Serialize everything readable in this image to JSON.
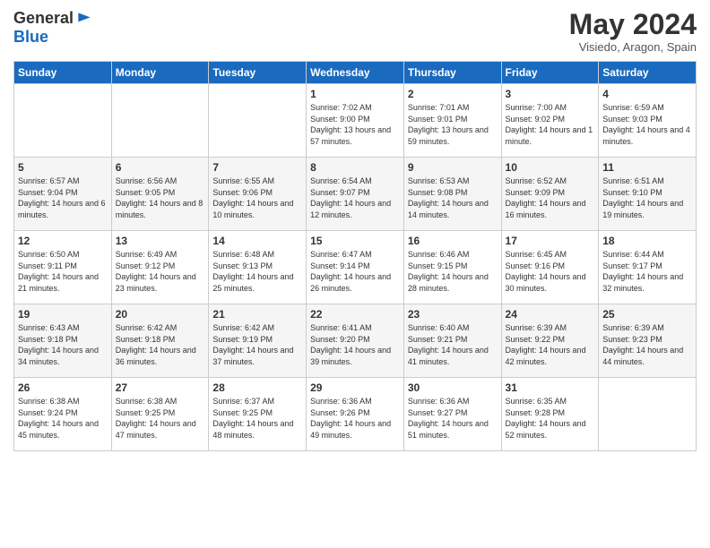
{
  "header": {
    "logo_line1": "General",
    "logo_line2": "Blue",
    "month_title": "May 2024",
    "location": "Visiedo, Aragon, Spain"
  },
  "weekdays": [
    "Sunday",
    "Monday",
    "Tuesday",
    "Wednesday",
    "Thursday",
    "Friday",
    "Saturday"
  ],
  "weeks": [
    [
      {
        "day": "",
        "sunrise": "",
        "sunset": "",
        "daylight": ""
      },
      {
        "day": "",
        "sunrise": "",
        "sunset": "",
        "daylight": ""
      },
      {
        "day": "",
        "sunrise": "",
        "sunset": "",
        "daylight": ""
      },
      {
        "day": "1",
        "sunrise": "Sunrise: 7:02 AM",
        "sunset": "Sunset: 9:00 PM",
        "daylight": "Daylight: 13 hours and 57 minutes."
      },
      {
        "day": "2",
        "sunrise": "Sunrise: 7:01 AM",
        "sunset": "Sunset: 9:01 PM",
        "daylight": "Daylight: 13 hours and 59 minutes."
      },
      {
        "day": "3",
        "sunrise": "Sunrise: 7:00 AM",
        "sunset": "Sunset: 9:02 PM",
        "daylight": "Daylight: 14 hours and 1 minute."
      },
      {
        "day": "4",
        "sunrise": "Sunrise: 6:59 AM",
        "sunset": "Sunset: 9:03 PM",
        "daylight": "Daylight: 14 hours and 4 minutes."
      }
    ],
    [
      {
        "day": "5",
        "sunrise": "Sunrise: 6:57 AM",
        "sunset": "Sunset: 9:04 PM",
        "daylight": "Daylight: 14 hours and 6 minutes."
      },
      {
        "day": "6",
        "sunrise": "Sunrise: 6:56 AM",
        "sunset": "Sunset: 9:05 PM",
        "daylight": "Daylight: 14 hours and 8 minutes."
      },
      {
        "day": "7",
        "sunrise": "Sunrise: 6:55 AM",
        "sunset": "Sunset: 9:06 PM",
        "daylight": "Daylight: 14 hours and 10 minutes."
      },
      {
        "day": "8",
        "sunrise": "Sunrise: 6:54 AM",
        "sunset": "Sunset: 9:07 PM",
        "daylight": "Daylight: 14 hours and 12 minutes."
      },
      {
        "day": "9",
        "sunrise": "Sunrise: 6:53 AM",
        "sunset": "Sunset: 9:08 PM",
        "daylight": "Daylight: 14 hours and 14 minutes."
      },
      {
        "day": "10",
        "sunrise": "Sunrise: 6:52 AM",
        "sunset": "Sunset: 9:09 PM",
        "daylight": "Daylight: 14 hours and 16 minutes."
      },
      {
        "day": "11",
        "sunrise": "Sunrise: 6:51 AM",
        "sunset": "Sunset: 9:10 PM",
        "daylight": "Daylight: 14 hours and 19 minutes."
      }
    ],
    [
      {
        "day": "12",
        "sunrise": "Sunrise: 6:50 AM",
        "sunset": "Sunset: 9:11 PM",
        "daylight": "Daylight: 14 hours and 21 minutes."
      },
      {
        "day": "13",
        "sunrise": "Sunrise: 6:49 AM",
        "sunset": "Sunset: 9:12 PM",
        "daylight": "Daylight: 14 hours and 23 minutes."
      },
      {
        "day": "14",
        "sunrise": "Sunrise: 6:48 AM",
        "sunset": "Sunset: 9:13 PM",
        "daylight": "Daylight: 14 hours and 25 minutes."
      },
      {
        "day": "15",
        "sunrise": "Sunrise: 6:47 AM",
        "sunset": "Sunset: 9:14 PM",
        "daylight": "Daylight: 14 hours and 26 minutes."
      },
      {
        "day": "16",
        "sunrise": "Sunrise: 6:46 AM",
        "sunset": "Sunset: 9:15 PM",
        "daylight": "Daylight: 14 hours and 28 minutes."
      },
      {
        "day": "17",
        "sunrise": "Sunrise: 6:45 AM",
        "sunset": "Sunset: 9:16 PM",
        "daylight": "Daylight: 14 hours and 30 minutes."
      },
      {
        "day": "18",
        "sunrise": "Sunrise: 6:44 AM",
        "sunset": "Sunset: 9:17 PM",
        "daylight": "Daylight: 14 hours and 32 minutes."
      }
    ],
    [
      {
        "day": "19",
        "sunrise": "Sunrise: 6:43 AM",
        "sunset": "Sunset: 9:18 PM",
        "daylight": "Daylight: 14 hours and 34 minutes."
      },
      {
        "day": "20",
        "sunrise": "Sunrise: 6:42 AM",
        "sunset": "Sunset: 9:18 PM",
        "daylight": "Daylight: 14 hours and 36 minutes."
      },
      {
        "day": "21",
        "sunrise": "Sunrise: 6:42 AM",
        "sunset": "Sunset: 9:19 PM",
        "daylight": "Daylight: 14 hours and 37 minutes."
      },
      {
        "day": "22",
        "sunrise": "Sunrise: 6:41 AM",
        "sunset": "Sunset: 9:20 PM",
        "daylight": "Daylight: 14 hours and 39 minutes."
      },
      {
        "day": "23",
        "sunrise": "Sunrise: 6:40 AM",
        "sunset": "Sunset: 9:21 PM",
        "daylight": "Daylight: 14 hours and 41 minutes."
      },
      {
        "day": "24",
        "sunrise": "Sunrise: 6:39 AM",
        "sunset": "Sunset: 9:22 PM",
        "daylight": "Daylight: 14 hours and 42 minutes."
      },
      {
        "day": "25",
        "sunrise": "Sunrise: 6:39 AM",
        "sunset": "Sunset: 9:23 PM",
        "daylight": "Daylight: 14 hours and 44 minutes."
      }
    ],
    [
      {
        "day": "26",
        "sunrise": "Sunrise: 6:38 AM",
        "sunset": "Sunset: 9:24 PM",
        "daylight": "Daylight: 14 hours and 45 minutes."
      },
      {
        "day": "27",
        "sunrise": "Sunrise: 6:38 AM",
        "sunset": "Sunset: 9:25 PM",
        "daylight": "Daylight: 14 hours and 47 minutes."
      },
      {
        "day": "28",
        "sunrise": "Sunrise: 6:37 AM",
        "sunset": "Sunset: 9:25 PM",
        "daylight": "Daylight: 14 hours and 48 minutes."
      },
      {
        "day": "29",
        "sunrise": "Sunrise: 6:36 AM",
        "sunset": "Sunset: 9:26 PM",
        "daylight": "Daylight: 14 hours and 49 minutes."
      },
      {
        "day": "30",
        "sunrise": "Sunrise: 6:36 AM",
        "sunset": "Sunset: 9:27 PM",
        "daylight": "Daylight: 14 hours and 51 minutes."
      },
      {
        "day": "31",
        "sunrise": "Sunrise: 6:35 AM",
        "sunset": "Sunset: 9:28 PM",
        "daylight": "Daylight: 14 hours and 52 minutes."
      },
      {
        "day": "",
        "sunrise": "",
        "sunset": "",
        "daylight": ""
      }
    ]
  ]
}
